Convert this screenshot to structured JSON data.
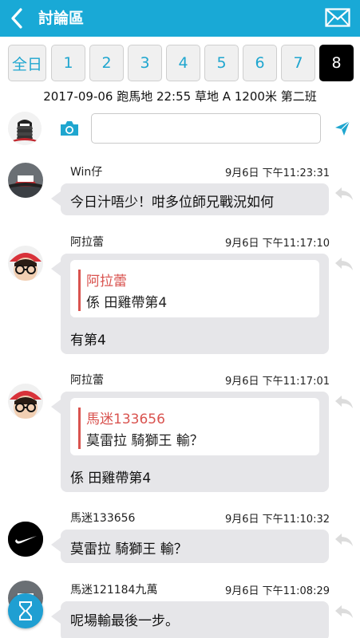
{
  "header": {
    "title": "討論區",
    "back_icon": "chevron-left-icon",
    "mail_icon": "mail-icon",
    "bg_color": "#19a9d6"
  },
  "race_tabs": {
    "items": [
      "全日",
      "1",
      "2",
      "3",
      "4",
      "5",
      "6",
      "7",
      "8"
    ],
    "selected": "8"
  },
  "race_info": "2017-09-06 跑馬地 22:55 草地 A 1200米 第二班",
  "composer": {
    "placeholder": "",
    "camera_icon": "camera-icon",
    "send_icon": "send-icon"
  },
  "messages": [
    {
      "sender": "Win仔",
      "time": "9月6日 下午11:23:31",
      "text": "今日汁唔少！咁多位師兄戰況如何"
    },
    {
      "sender": "阿拉蕾",
      "time": "9月6日 下午11:17:10",
      "quote_name": "阿拉蕾",
      "quote_text": "係 田雞帶第4",
      "text": "有第4"
    },
    {
      "sender": "阿拉蕾",
      "time": "9月6日 下午11:17:01",
      "quote_name": "馬迷133656",
      "quote_text": "莫雷拉 騎獅王 輸？",
      "text": "係 田雞帶第4"
    },
    {
      "sender": "馬迷133656",
      "time": "9月6日 下午11:10:32",
      "text": "莫雷拉 騎獅王 輸？"
    },
    {
      "sender": "馬迷121184九萬",
      "time": "9月6日 下午11:08:29",
      "text": "呢場輸最後一步。"
    }
  ],
  "colors": {
    "accent": "#19a9d6",
    "quote_name": "#d9534f",
    "bubble": "#e6e6e9"
  }
}
